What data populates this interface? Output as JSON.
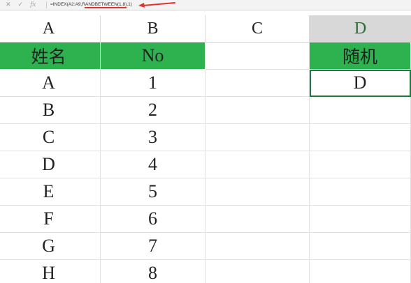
{
  "formula_bar": {
    "cancel_icon": "close-icon",
    "enter_icon": "check-icon",
    "fx_label": "fx",
    "formula": "=INDEX(A2:A9,RANDBETWEEN(1,8),1)"
  },
  "columns": [
    "A",
    "B",
    "C",
    "D"
  ],
  "selected_column": "D",
  "header_row": {
    "a": "姓名",
    "b": "No",
    "c": "",
    "d": "随机"
  },
  "rows": [
    {
      "a": "A",
      "b": "1",
      "c": "",
      "d": "D"
    },
    {
      "a": "B",
      "b": "2",
      "c": "",
      "d": ""
    },
    {
      "a": "C",
      "b": "3",
      "c": "",
      "d": ""
    },
    {
      "a": "D",
      "b": "4",
      "c": "",
      "d": ""
    },
    {
      "a": "E",
      "b": "5",
      "c": "",
      "d": ""
    },
    {
      "a": "F",
      "b": "6",
      "c": "",
      "d": ""
    },
    {
      "a": "G",
      "b": "7",
      "c": "",
      "d": ""
    },
    {
      "a": "H",
      "b": "8",
      "c": "",
      "d": ""
    }
  ],
  "colors": {
    "header_fill": "#2eb24f",
    "annotation": "#e0332b",
    "selected_header": "#d8d8d8"
  }
}
